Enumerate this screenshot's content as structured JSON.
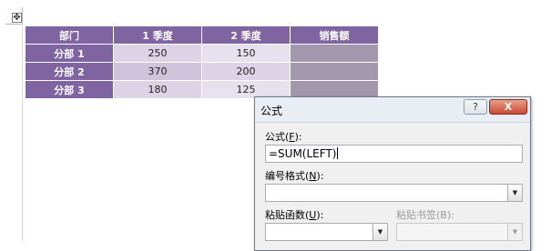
{
  "table": {
    "headers": [
      "部门",
      "1 季度",
      "2 季度",
      "销售额"
    ],
    "rows": [
      {
        "dept": "分部 1",
        "q1": "250",
        "q2": "150",
        "sales": ""
      },
      {
        "dept": "分部 2",
        "q1": "370",
        "q2": "200",
        "sales": ""
      },
      {
        "dept": "分部 3",
        "q1": "180",
        "q2": "125",
        "sales": ""
      }
    ]
  },
  "table_handle_icon": "move-handle-icon",
  "dialog": {
    "title": "公式",
    "help_label": "?",
    "close_label": "X",
    "formula_label_pre": "公式(",
    "formula_label_key": "F",
    "formula_label_post": "):",
    "formula_value": "=SUM(LEFT)",
    "number_format_label_pre": "编号格式(",
    "number_format_label_key": "N",
    "number_format_label_post": "):",
    "number_format_value": "",
    "paste_function_label_pre": "粘贴函数(",
    "paste_function_label_key": "U",
    "paste_function_label_post": "):",
    "paste_function_value": "",
    "paste_bookmark_label": "粘贴书签(B):",
    "paste_bookmark_value": ""
  },
  "colors": {
    "table_header": "#8064a2",
    "dialog_title_bg": "#e9eef5",
    "close_button": "#c94a35"
  }
}
